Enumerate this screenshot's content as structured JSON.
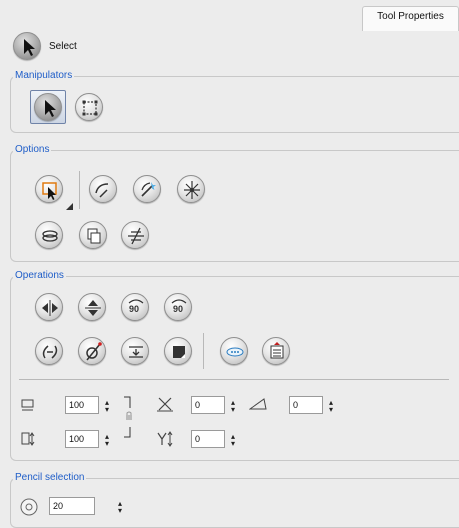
{
  "tab": {
    "label": "Tool Properties"
  },
  "header": {
    "tool_label": "Select"
  },
  "sections": {
    "manipulators": {
      "title": "Manipulators"
    },
    "options": {
      "title": "Options"
    },
    "operations": {
      "title": "Operations"
    },
    "pencil": {
      "title": "Pencil selection"
    }
  },
  "fields": {
    "width": "100",
    "height": "100",
    "x_offset": "0",
    "y_offset": "0",
    "angle": "0",
    "pencil_size": "20"
  },
  "colors": {
    "legend": "#1e5dc8",
    "accent_orange": "#e07a10"
  }
}
